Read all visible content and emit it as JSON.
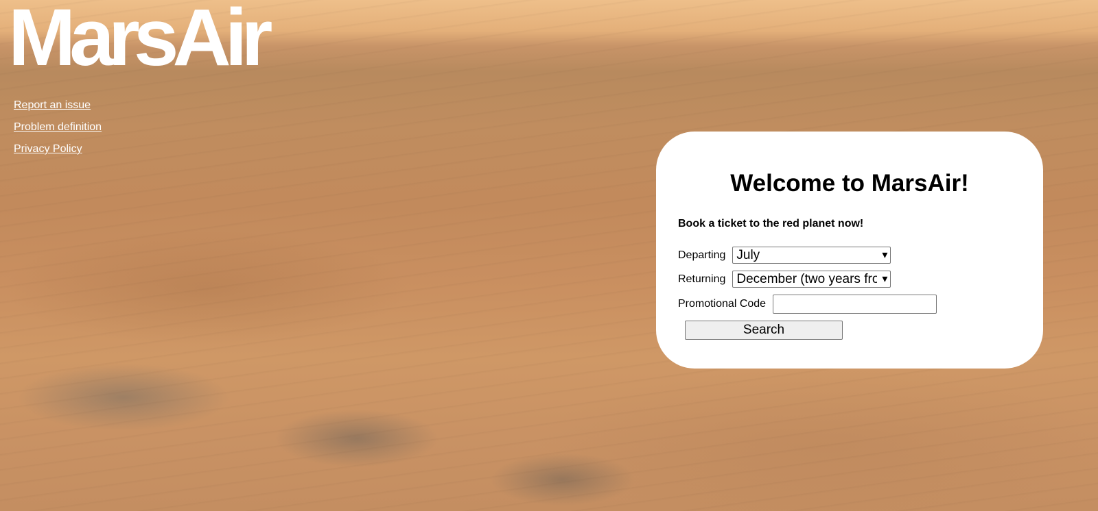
{
  "brand": {
    "logo_text": "MarsAir"
  },
  "nav": {
    "links": [
      {
        "label": "Report an issue"
      },
      {
        "label": "Problem definition"
      },
      {
        "label": "Privacy Policy"
      }
    ]
  },
  "booking": {
    "title": "Welcome to MarsAir!",
    "tagline": "Book a ticket to the red planet now!",
    "departing_label": "Departing",
    "departing_value": "July",
    "returning_label": "Returning",
    "returning_value": "December (two years from now)",
    "promo_label": "Promotional Code",
    "promo_value": "",
    "search_label": "Search"
  },
  "icons": {
    "select_arrow": "chevron-down-icon"
  },
  "colors": {
    "link": "#ffffff",
    "panel_bg": "#ffffff",
    "sky": "#eebf8a",
    "ground": "#c98f60"
  }
}
